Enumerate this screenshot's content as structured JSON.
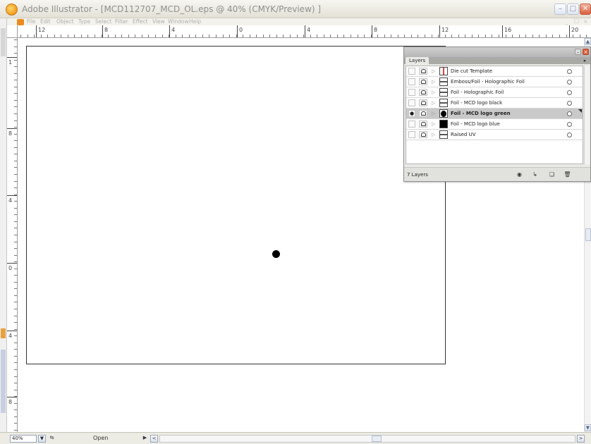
{
  "window": {
    "title": "Adobe Illustrator - [MCD112707_MCD_OL.eps @ 40% (CMYK/Preview) ]",
    "minimize": "–",
    "maximize": "□",
    "close": "✕"
  },
  "menubar": {
    "items": [
      "File",
      "Edit",
      "Object",
      "Type",
      "Select",
      "Filter",
      "Effect",
      "View",
      "Window",
      "Help"
    ],
    "doc_controls": [
      "_",
      "☐",
      "×"
    ]
  },
  "rulers": {
    "top_labels": [
      "12",
      "8",
      "4",
      "0",
      "4",
      "8",
      "12",
      "16",
      "20"
    ],
    "left_labels": [
      "1",
      "8",
      "4",
      "0",
      "4",
      "8"
    ]
  },
  "layers_panel": {
    "tab_label": "Layers",
    "menu_glyph": "▸",
    "layers": [
      {
        "name": "Die cut Template",
        "visible": false,
        "selected": false,
        "thumb": "die-cut"
      },
      {
        "name": "Emboss/Foil - Holographic Foil",
        "visible": false,
        "selected": false,
        "thumb": "line"
      },
      {
        "name": "Foil - Holographic Foil",
        "visible": false,
        "selected": false,
        "thumb": "line"
      },
      {
        "name": "Foil - MCD logo black",
        "visible": false,
        "selected": false,
        "thumb": "line"
      },
      {
        "name": "Foil - MCD logo green",
        "visible": true,
        "selected": true,
        "thumb": "blob"
      },
      {
        "name": "Foil - MCD logo blue",
        "visible": false,
        "selected": false,
        "thumb": "solid"
      },
      {
        "name": "Raised UV",
        "visible": false,
        "selected": false,
        "thumb": "line"
      }
    ],
    "visible_glyph": "●",
    "layer_count": "7 Layers",
    "footer_icons": [
      "make-clipping-mask-icon",
      "create-sublayer-icon",
      "create-layer-icon",
      "trash-icon"
    ]
  },
  "statusbar": {
    "zoom": "40%",
    "status_text": "Open",
    "play_glyph": "▶",
    "left_glyph": "<",
    "right_glyph": ">"
  }
}
